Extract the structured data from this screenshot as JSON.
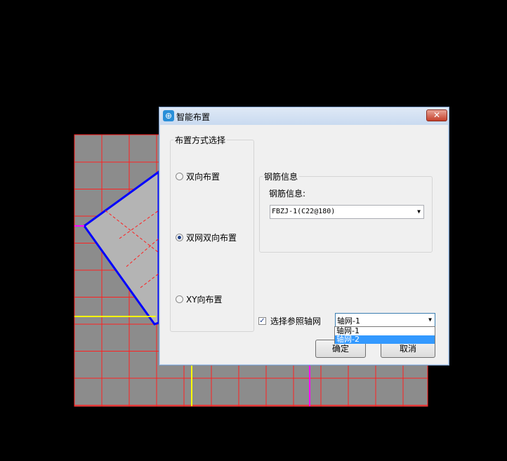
{
  "dialog": {
    "title": "智能布置",
    "close_symbol": "✕",
    "app_icon": "layout-icon"
  },
  "layout_group": {
    "legend": "布置方式选择",
    "options": [
      {
        "label": "双向布置",
        "checked": false
      },
      {
        "label": "双网双向布置",
        "checked": true
      },
      {
        "label": "XY向布置",
        "checked": false
      }
    ]
  },
  "rebar_group": {
    "legend": "钢筋信息",
    "field_label": "钢筋信息:",
    "combo_value": "FBZJ-1(C22@180)"
  },
  "axis_grid": {
    "checkbox_label": "选择参照轴网",
    "checked": true,
    "selected_value": "轴网-1",
    "dropdown_items": [
      "轴网-1",
      "轴网-2"
    ],
    "highlighted_index": 1
  },
  "buttons": {
    "ok": "确定",
    "cancel": "取消"
  },
  "colors": {
    "grid_fill": "#8c8c8c",
    "grid_line": "#ff2020",
    "axis_blue": "#0000ff",
    "axis_yellow": "#ffff00",
    "axis_magenta": "#ff00ff"
  }
}
